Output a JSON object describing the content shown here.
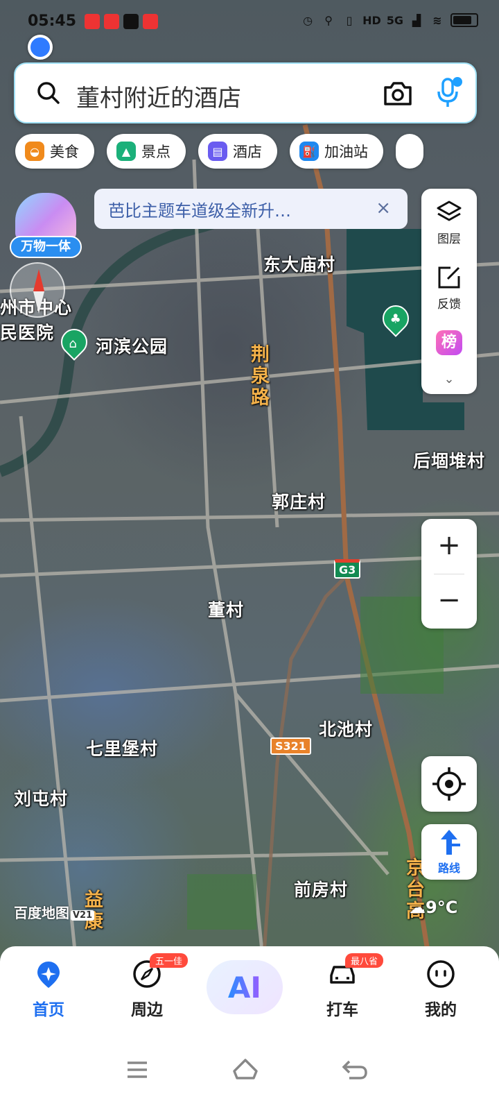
{
  "status_bar": {
    "time": "05:45",
    "network": "5G",
    "hd": "HD"
  },
  "search": {
    "query": "董村附近的酒店"
  },
  "chips": [
    {
      "label": "美食",
      "icon": "food-icon",
      "color": "#f08a1c"
    },
    {
      "label": "景点",
      "icon": "scenic-icon",
      "color": "#1bb07a"
    },
    {
      "label": "酒店",
      "icon": "hotel-icon",
      "color": "#6a5cf0"
    },
    {
      "label": "加油站",
      "icon": "gas-station-icon",
      "color": "#1e88f0"
    }
  ],
  "notice": {
    "text": "芭比主题车道级全新升…",
    "close": "×"
  },
  "promo": {
    "label": "万物一体"
  },
  "right_panel": {
    "layers_label": "图层",
    "feedback_label": "反馈",
    "rank_glyph": "榜"
  },
  "map": {
    "places": {
      "dongdamiao": "东大庙村",
      "hebin_park": "河滨公园",
      "guozhuang": "郭庄村",
      "dongcun": "董村",
      "beichi": "北池村",
      "qilibao": "七里堡村",
      "liutun": "刘屯村",
      "qianfang": "前房村",
      "houyindui": "后堌堆村",
      "city_center_partial": "州市中心",
      "hospital_partial": "民医院"
    },
    "roads": {
      "jingquan_road": "荆\n泉\n路",
      "jingtai_partial": "京\n台\n高",
      "yikang_partial": "益\n康"
    },
    "shields": {
      "g3": "G3",
      "s321": "S321"
    },
    "watermark": "百度地图",
    "watermark_version": "V21",
    "weather": "9°C"
  },
  "zoom": {
    "plus": "+",
    "minus": "−"
  },
  "route_label": "路线",
  "tabs": {
    "home": "首页",
    "nearby": "周边",
    "nearby_badge": "五一佳",
    "ai": "AI",
    "taxi": "打车",
    "taxi_badge": "最八省",
    "mine": "我的"
  }
}
